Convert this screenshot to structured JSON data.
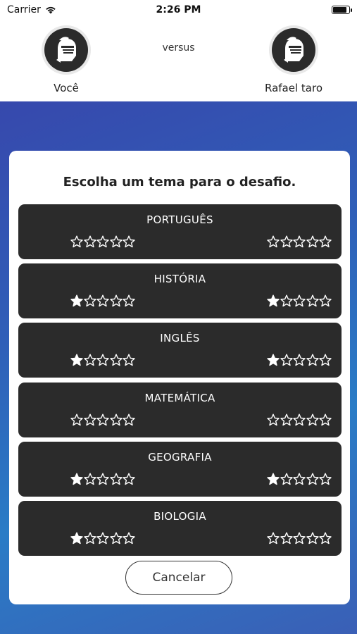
{
  "status": {
    "carrier": "Carrier",
    "time": "2:26 PM"
  },
  "header": {
    "player_left": "Você",
    "player_right": "Rafael taro",
    "versus": "versus"
  },
  "dialog": {
    "title": "Escolha um tema para o desafio.",
    "cancel_label": "Cancelar",
    "topics": [
      {
        "name": "PORTUGUÊS",
        "left_stars": 0,
        "right_stars": 0
      },
      {
        "name": "HISTÓRIA",
        "left_stars": 1,
        "right_stars": 1
      },
      {
        "name": "INGLÊS",
        "left_stars": 1,
        "right_stars": 1
      },
      {
        "name": "MATEMÁTICA",
        "left_stars": 0,
        "right_stars": 0
      },
      {
        "name": "GEOGRAFIA",
        "left_stars": 1,
        "right_stars": 1
      },
      {
        "name": "BIOLOGIA",
        "left_stars": 1,
        "right_stars": 0
      }
    ]
  },
  "icons": {
    "avatar": "knight-helmet-icon",
    "star": "star-icon"
  },
  "colors": {
    "topic_background": "#2b2b2b",
    "accent_gradient": [
      "#3a3fa8",
      "#2a7cc6"
    ]
  }
}
